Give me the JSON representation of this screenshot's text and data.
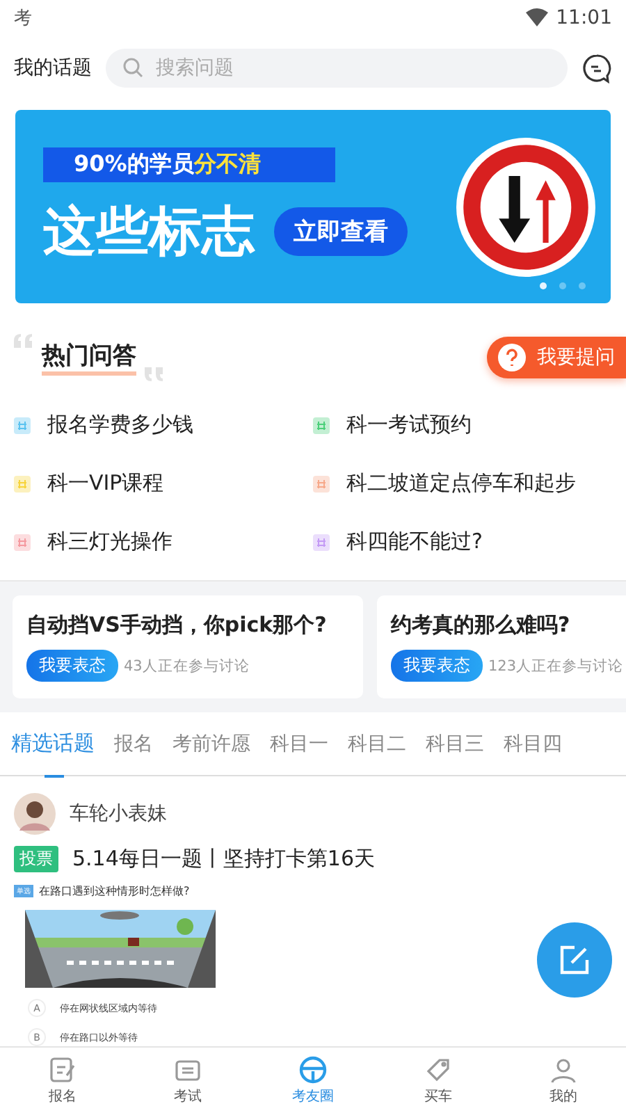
{
  "status_bar": {
    "app_glyph": "考",
    "time": "11:01"
  },
  "header": {
    "my_topics": "我的话题",
    "search": {
      "placeholder": "搜索问题"
    }
  },
  "banner": {
    "tagline": "90%的学员",
    "tagline_highlight": "分不清",
    "headline": "这些标志",
    "button": "立即查看",
    "dots": [
      {
        "selected": true
      },
      {
        "selected": false
      },
      {
        "selected": false
      }
    ]
  },
  "hot": {
    "title": "热门问答",
    "ask_button": "我要提问",
    "items": [
      {
        "label": "报名学费多少钱",
        "color": "#5bc3f0"
      },
      {
        "label": "科一考试预约",
        "color": "#4cd07a"
      },
      {
        "label": "科一VIP课程",
        "color": "#f7d43c"
      },
      {
        "label": "科二坡道定点停车和起步",
        "color": "#f7a98a"
      },
      {
        "label": "科三灯光操作",
        "color": "#f59aa0"
      },
      {
        "label": "科四能不能过?",
        "color": "#c49bf5"
      }
    ]
  },
  "topic_cards": [
    {
      "title": "自动挡VS手动挡，你pick那个?",
      "button": "我要表态",
      "count": "43人正在参与讨论"
    },
    {
      "title": "约考真的那么难吗?",
      "button": "我要表态",
      "count": "123人正在参与讨论"
    }
  ],
  "tabs": [
    {
      "label": "精选话题",
      "selected": true
    },
    {
      "label": "报名",
      "selected": false
    },
    {
      "label": "考前许愿",
      "selected": false
    },
    {
      "label": "科目一",
      "selected": false
    },
    {
      "label": "科目二",
      "selected": false
    },
    {
      "label": "科目三",
      "selected": false
    },
    {
      "label": "科目四",
      "selected": false
    }
  ],
  "post": {
    "author": "车轮小表妹",
    "tag": "投票",
    "title": "5.14每日一题丨坚持打卡第16天",
    "question_type": "单选",
    "question": "在路口遇到这种情形时怎样做?",
    "options": [
      {
        "letter": "A",
        "text": "停在网状线区域内等待"
      },
      {
        "letter": "B",
        "text": "停在路口以外等待"
      }
    ]
  },
  "bottom_nav": [
    {
      "label": "报名",
      "kind": "form",
      "selected": false
    },
    {
      "label": "考试",
      "kind": "paper",
      "selected": false
    },
    {
      "label": "考友圈",
      "kind": "wheel",
      "selected": true
    },
    {
      "label": "买车",
      "kind": "tag",
      "selected": false
    },
    {
      "label": "我的",
      "kind": "person",
      "selected": false
    }
  ]
}
